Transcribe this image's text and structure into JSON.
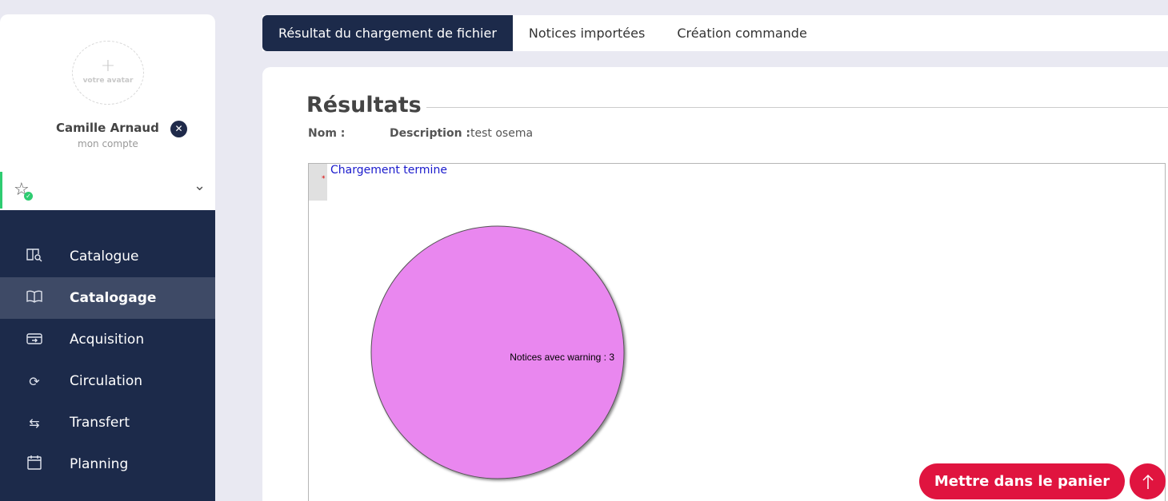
{
  "user": {
    "avatar_plus": "+",
    "avatar_label": "votre avatar",
    "name": "Camille Arnaud",
    "account_label": "mon compte"
  },
  "nav": [
    {
      "label": "Catalogue",
      "icon": "catalog-search-icon"
    },
    {
      "label": "Catalogage",
      "icon": "open-book-icon",
      "active": true
    },
    {
      "label": "Acquisition",
      "icon": "inbox-icon"
    },
    {
      "label": "Circulation",
      "icon": "refresh-icon"
    },
    {
      "label": "Transfert",
      "icon": "transfer-arrows-icon"
    },
    {
      "label": "Planning",
      "icon": "calendar-icon"
    }
  ],
  "tabs": [
    {
      "label": "Résultat du chargement de fichier",
      "active": true
    },
    {
      "label": "Notices importées"
    },
    {
      "label": "Création commande"
    }
  ],
  "results": {
    "title": "Résultats",
    "nom_label": "Nom :",
    "description_label": "Description :",
    "description_value": "test osema",
    "status": "Chargement termine"
  },
  "chart_data": {
    "type": "pie",
    "slices": [
      {
        "label": "Notices avec warning",
        "value": 3,
        "color": "#e987ef"
      }
    ],
    "labels": [
      "Notices avec warning : 3"
    ]
  },
  "actions": {
    "cart_label": "Mettre dans le panier",
    "back_to_top_icon": "arrow-up-icon"
  },
  "colors": {
    "nav_bg": "#1c2a4a",
    "accent": "#e0143f",
    "pie": "#e987ef"
  }
}
